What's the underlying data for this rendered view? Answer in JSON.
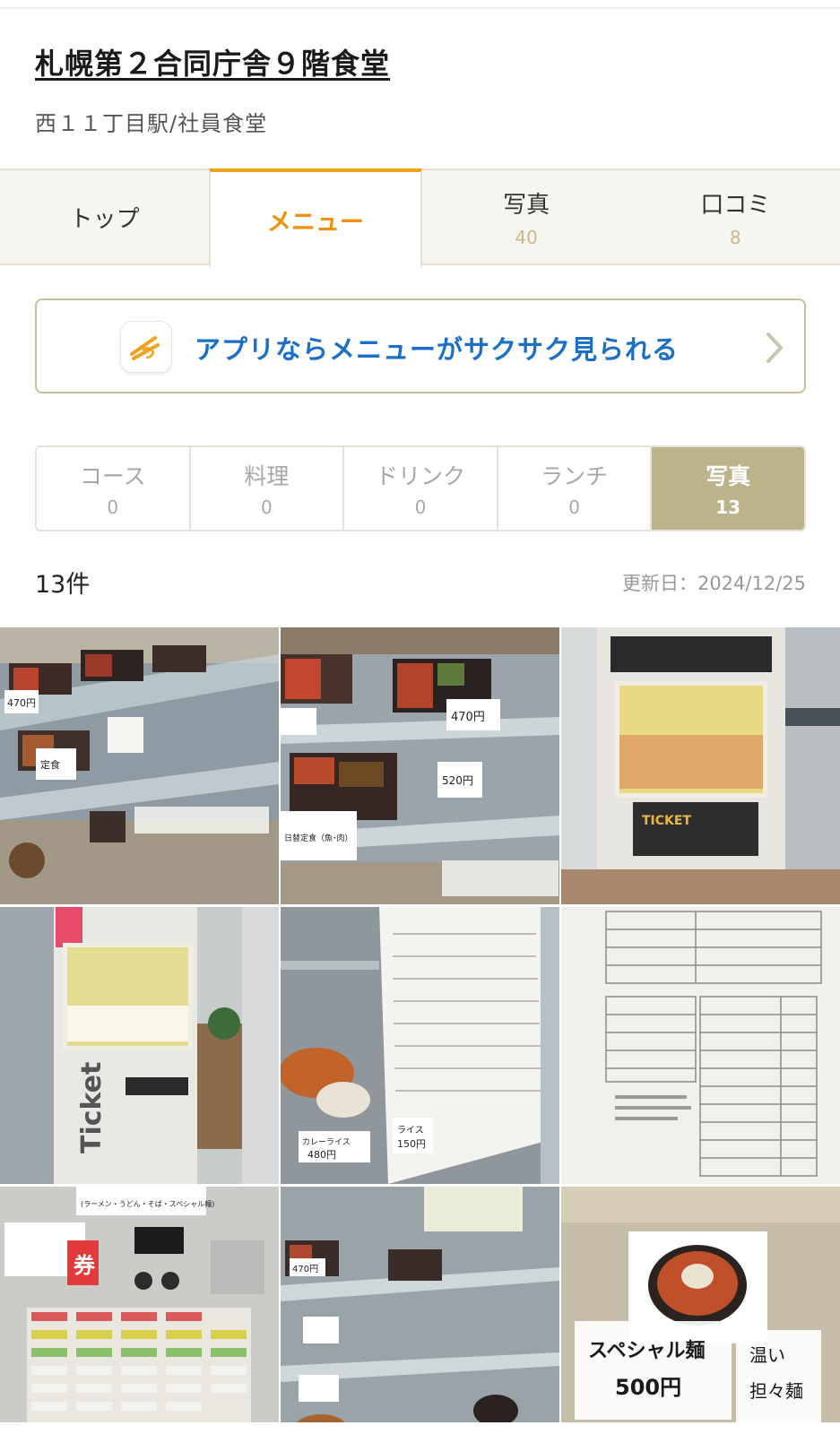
{
  "store": {
    "name": "札幌第２合同庁舎９階食堂",
    "subtitle": "西１１丁目駅/社員食堂"
  },
  "tabs": [
    {
      "label": "トップ",
      "count": ""
    },
    {
      "label": "メニュー",
      "count": ""
    },
    {
      "label": "写真",
      "count": "40"
    },
    {
      "label": "口コミ",
      "count": "8"
    }
  ],
  "app_banner": {
    "text": "アプリならメニューがサクサク見られる",
    "icon": "chopsticks-app-icon"
  },
  "subtabs": [
    {
      "label": "コース",
      "count": "0"
    },
    {
      "label": "料理",
      "count": "0"
    },
    {
      "label": "ドリンク",
      "count": "0"
    },
    {
      "label": "ランチ",
      "count": "0"
    },
    {
      "label": "写真",
      "count": "13"
    }
  ],
  "list": {
    "count_label": "13件",
    "updated": "更新日：2024/12/25"
  },
  "photo_labels": {
    "p1": [
      "470円",
      "定食"
    ],
    "p2": [
      "470円",
      "520円",
      "日替定食（魚･肉）",
      "（魚・肉）"
    ],
    "p3": [
      "TICKET"
    ],
    "p4": [
      "Ticket"
    ],
    "p5": [
      "カレーライス",
      "480円",
      "ライス",
      "150円"
    ],
    "p7": [
      "(ラーメン・うどん・そば・スペシャル麺)",
      "券"
    ],
    "p8": [
      "470円"
    ],
    "p9": [
      "スペシャル麺",
      "500円",
      "温い",
      "担々麺"
    ]
  },
  "colors": {
    "accent_orange": "#f0920f",
    "link_blue": "#1b6fc4",
    "active_subtab": "#bdb38a"
  }
}
